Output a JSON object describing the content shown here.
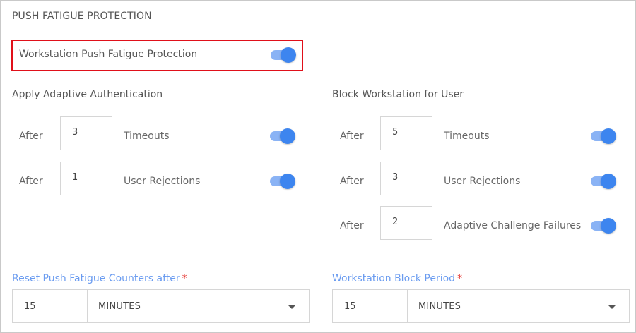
{
  "section_title": "PUSH FATIGUE PROTECTION",
  "main_toggle": {
    "label": "Workstation Push Fatigue Protection",
    "enabled": true
  },
  "adaptive": {
    "heading": "Apply Adaptive Authentication",
    "rows": [
      {
        "prefix": "After",
        "value": "3",
        "label": "Timeouts",
        "enabled": true
      },
      {
        "prefix": "After",
        "value": "1",
        "label": "User Rejections",
        "enabled": true
      }
    ]
  },
  "block": {
    "heading": "Block Workstation for User",
    "rows": [
      {
        "prefix": "After",
        "value": "5",
        "label": "Timeouts",
        "enabled": true
      },
      {
        "prefix": "After",
        "value": "3",
        "label": "User Rejections",
        "enabled": true
      },
      {
        "prefix": "After",
        "value": "2",
        "label": "Adaptive Challenge Failures",
        "enabled": true
      }
    ]
  },
  "reset_counters": {
    "label": "Reset Push Fatigue Counters after",
    "required_mark": "*",
    "value": "15",
    "unit": "MINUTES"
  },
  "block_period": {
    "label": "Workstation Block Period",
    "required_mark": "*",
    "value": "15",
    "unit": "MINUTES"
  },
  "colors": {
    "accent": "#3d85ef",
    "accent_light": "#8ab3f5",
    "highlight_border": "#e0101a",
    "field_label": "#6b9cf0",
    "required": "#e53935"
  }
}
